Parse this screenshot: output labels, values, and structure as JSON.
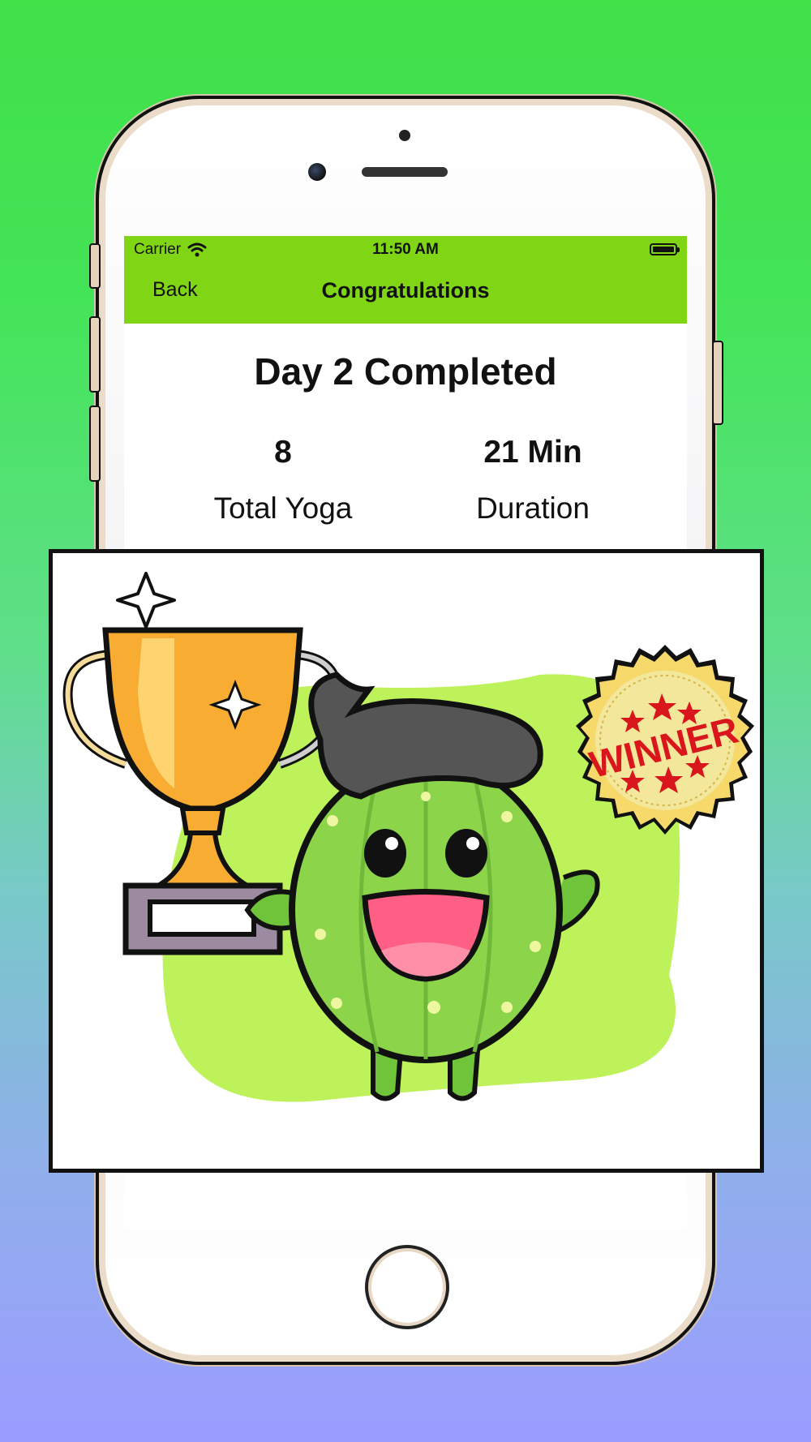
{
  "status_bar": {
    "carrier": "Carrier",
    "time": "11:50 AM"
  },
  "nav": {
    "back_label": "Back",
    "title": "Congratulations",
    "background_color": "#80d615"
  },
  "summary": {
    "title": "Day 2 Completed",
    "stats": [
      {
        "value": "8",
        "label": "Total Yoga"
      },
      {
        "value": "21 Min",
        "label": "Duration"
      }
    ]
  },
  "illustration": {
    "badge_text": "WINNER",
    "subject": "happy cactus holding golden trophy"
  }
}
